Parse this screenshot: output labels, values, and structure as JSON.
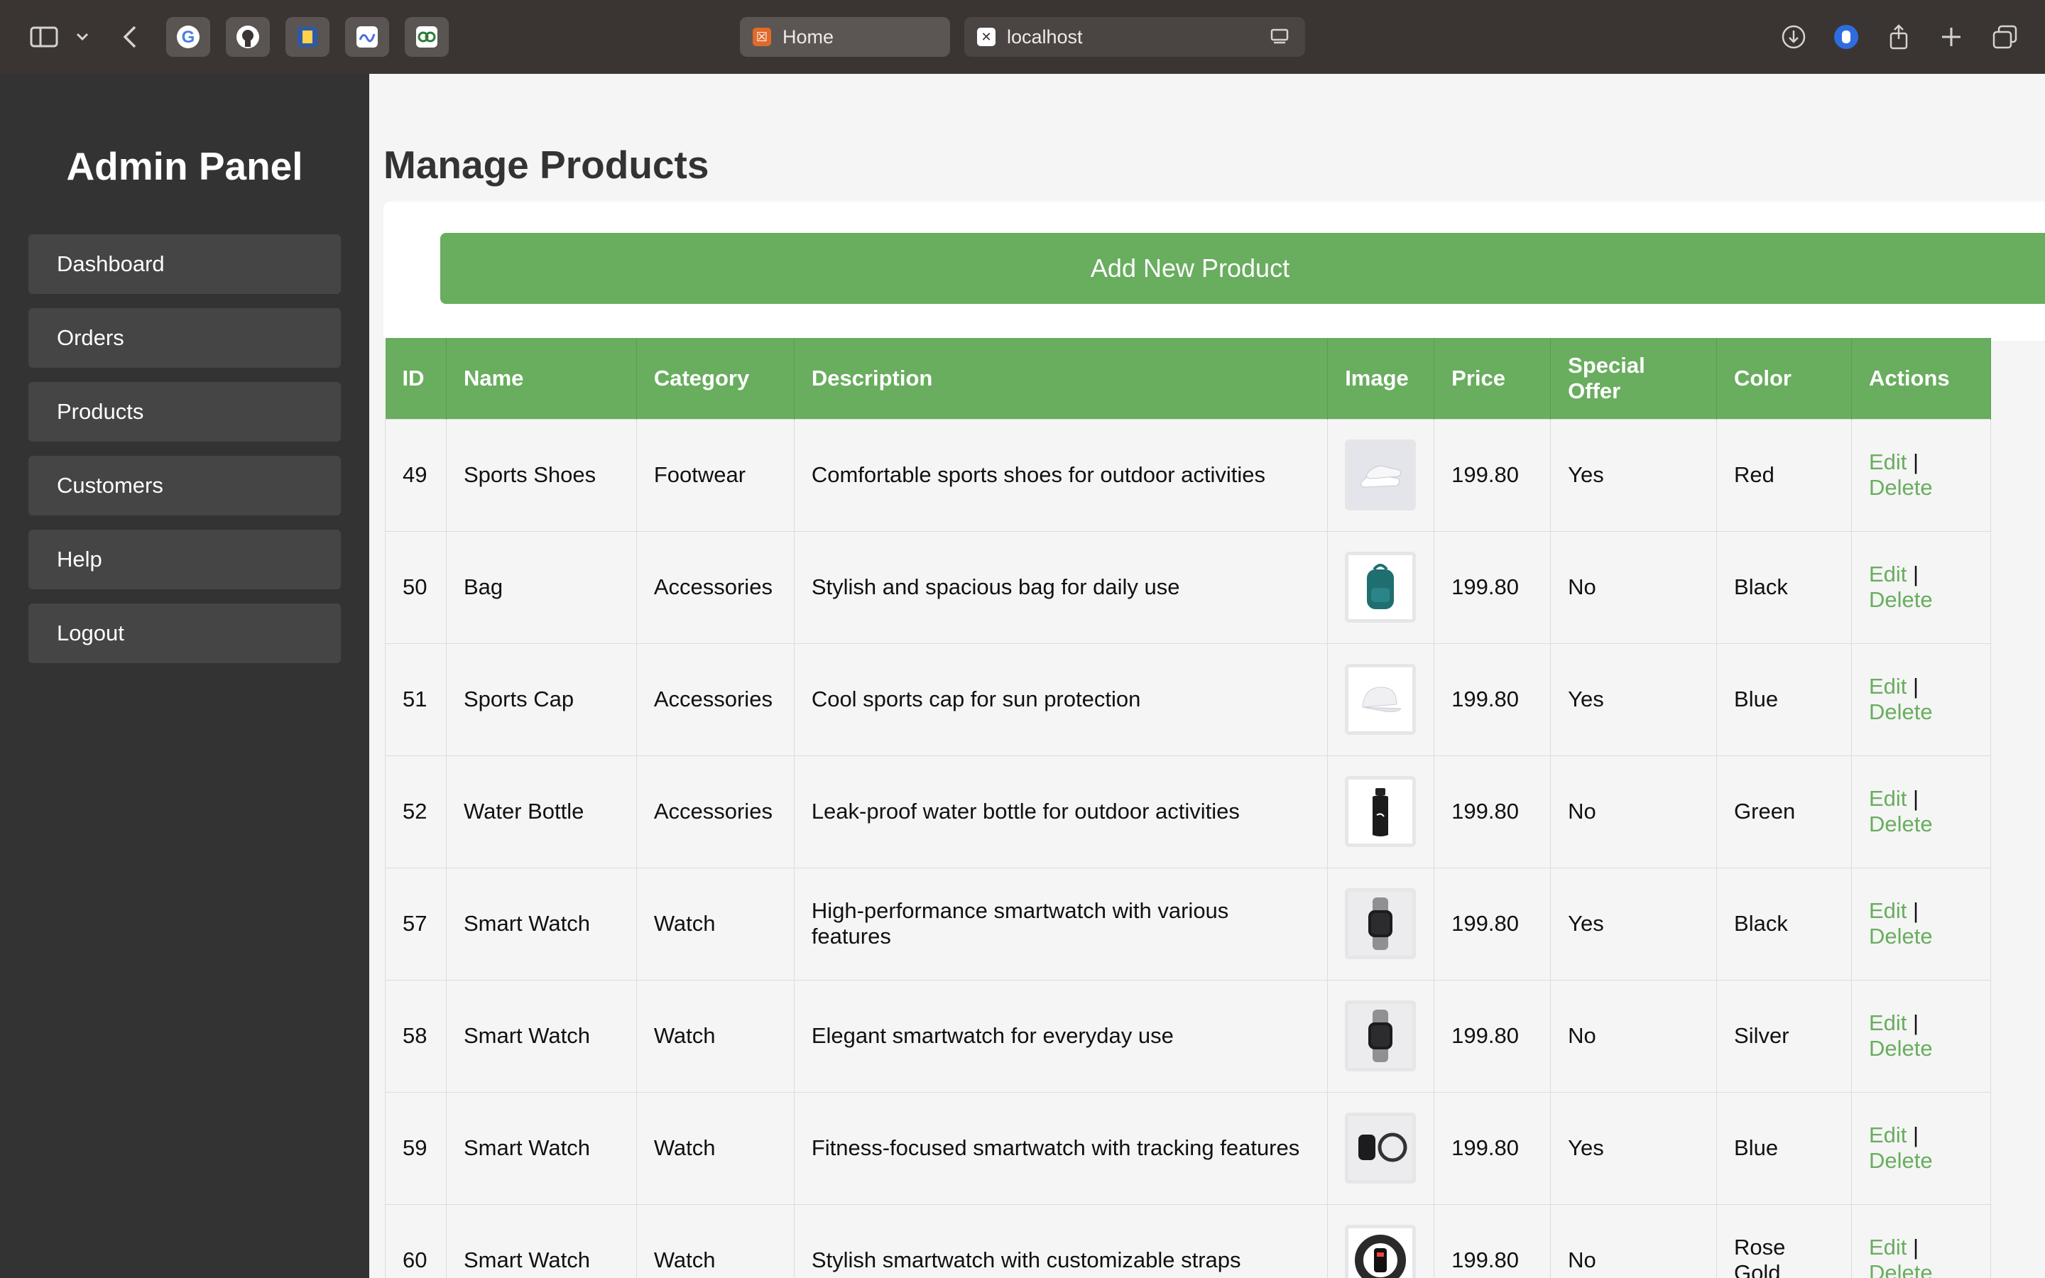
{
  "browser": {
    "tabs": [
      {
        "label": "Home"
      },
      {
        "label": "localhost"
      }
    ]
  },
  "sidebar": {
    "title": "Admin Panel",
    "items": [
      {
        "label": "Dashboard"
      },
      {
        "label": "Orders"
      },
      {
        "label": "Products"
      },
      {
        "label": "Customers"
      },
      {
        "label": "Help"
      },
      {
        "label": "Logout"
      }
    ]
  },
  "main": {
    "title": "Manage Products",
    "add_button": "Add New Product",
    "table": {
      "headers": [
        "ID",
        "Name",
        "Category",
        "Description",
        "Image",
        "Price",
        "Special Offer",
        "Color",
        "Actions"
      ],
      "edit_label": "Edit",
      "separator": "|",
      "delete_label": "Delete",
      "rows": [
        {
          "id": "49",
          "name": "Sports Shoes",
          "category": "Footwear",
          "description": "Comfortable sports shoes for outdoor activities",
          "image": "shoes-image",
          "price": "199.80",
          "special": "Yes",
          "color": "Red"
        },
        {
          "id": "50",
          "name": "Bag",
          "category": "Accessories",
          "description": "Stylish and spacious bag for daily use",
          "image": "backpack-image",
          "price": "199.80",
          "special": "No",
          "color": "Black"
        },
        {
          "id": "51",
          "name": "Sports Cap",
          "category": "Accessories",
          "description": "Cool sports cap for sun protection",
          "image": "cap-image",
          "price": "199.80",
          "special": "Yes",
          "color": "Blue"
        },
        {
          "id": "52",
          "name": "Water Bottle",
          "category": "Accessories",
          "description": "Leak-proof water bottle for outdoor activities",
          "image": "bottle-image",
          "price": "199.80",
          "special": "No",
          "color": "Green"
        },
        {
          "id": "57",
          "name": "Smart Watch",
          "category": "Watch",
          "description": "High-performance smartwatch with various features",
          "image": "watch-image",
          "price": "199.80",
          "special": "Yes",
          "color": "Black"
        },
        {
          "id": "58",
          "name": "Smart Watch",
          "category": "Watch",
          "description": "Elegant smartwatch for everyday use",
          "image": "watch-image",
          "price": "199.80",
          "special": "No",
          "color": "Silver"
        },
        {
          "id": "59",
          "name": "Smart Watch",
          "category": "Watch",
          "description": "Fitness-focused smartwatch with tracking features",
          "image": "watch-pair-image",
          "price": "199.80",
          "special": "Yes",
          "color": "Blue"
        },
        {
          "id": "60",
          "name": "Smart Watch",
          "category": "Watch",
          "description": "Stylish smartwatch with customizable straps",
          "image": "band-watch-image",
          "price": "199.80",
          "special": "No",
          "color": "Rose Gold"
        }
      ]
    }
  },
  "colors": {
    "accent_green": "#69ad5f",
    "sidebar_bg": "#333333",
    "nav_item_bg": "#454545",
    "chrome_bg": "#3a3533"
  }
}
